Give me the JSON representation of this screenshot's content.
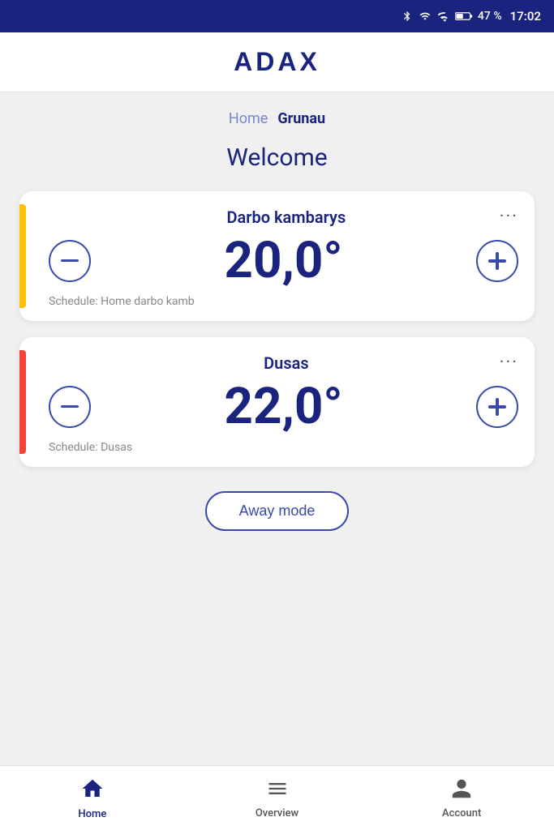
{
  "statusBar": {
    "battery": "47 %",
    "time": "17:02"
  },
  "header": {
    "logo": "ADAX"
  },
  "breadcrumb": {
    "home": "Home",
    "current": "Grunau"
  },
  "welcome": {
    "title": "Welcome"
  },
  "cards": [
    {
      "id": "card1",
      "name": "Darbo kambarys",
      "temperature": "20,0°",
      "schedule": "Schedule: Home darbo kamb",
      "indicator": "yellow"
    },
    {
      "id": "card2",
      "name": "Dusas",
      "temperature": "22,0°",
      "schedule": "Schedule: Dusas",
      "indicator": "orange"
    }
  ],
  "awayMode": {
    "label": "Away mode"
  },
  "bottomNav": {
    "items": [
      {
        "id": "home",
        "label": "Home",
        "active": true
      },
      {
        "id": "overview",
        "label": "Overview",
        "active": false
      },
      {
        "id": "account",
        "label": "Account",
        "active": false
      }
    ]
  }
}
